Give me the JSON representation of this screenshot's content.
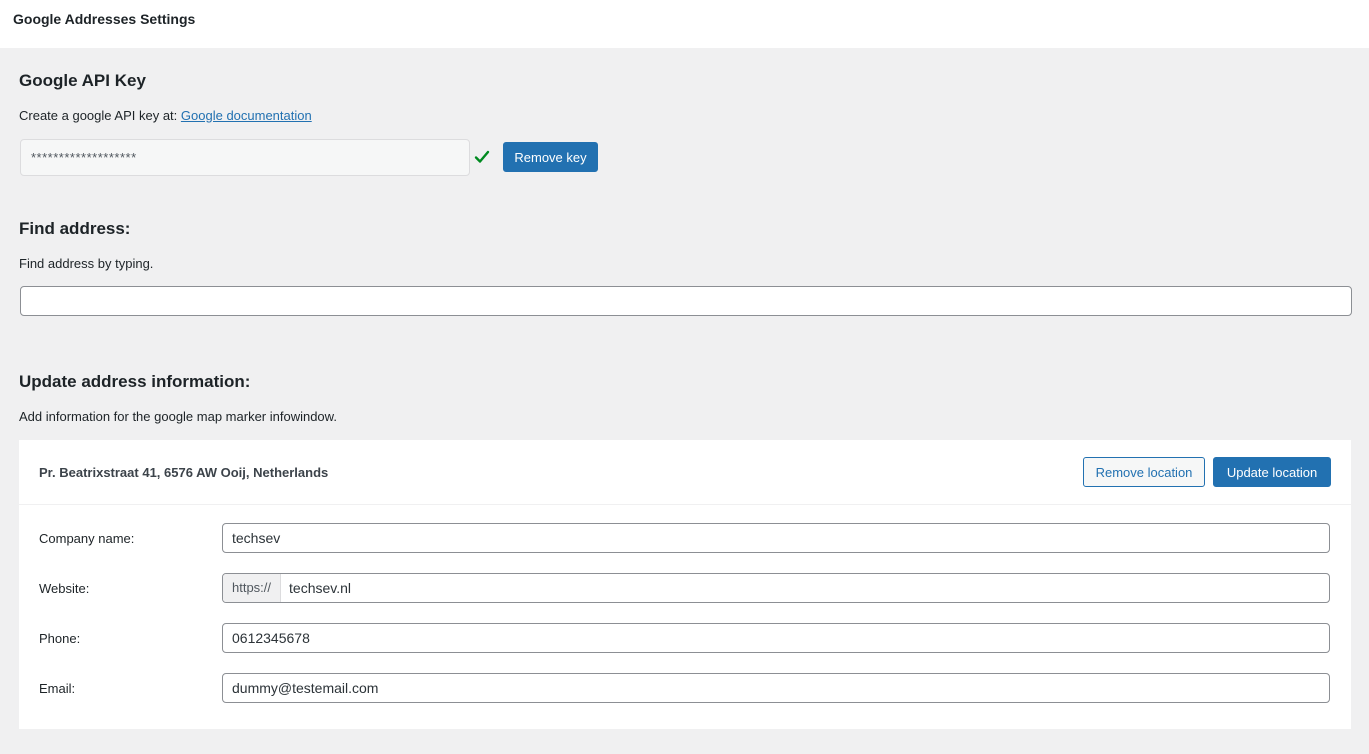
{
  "header": {
    "title": "Google Addresses Settings"
  },
  "api_key": {
    "heading": "Google API Key",
    "description_prefix": "Create a google API key at:",
    "doc_link": "Google documentation",
    "masked_value": "*******************",
    "status_icon": "checkmark-icon",
    "remove_label": "Remove key"
  },
  "find": {
    "heading": "Find address:",
    "description": "Find address by typing.",
    "value": ""
  },
  "update": {
    "heading": "Update address information:",
    "description": "Add information for the google map marker infowindow.",
    "address": "Pr. Beatrixstraat 41, 6576 AW Ooij, Netherlands",
    "remove_location": "Remove location",
    "update_location": "Update location",
    "fields": {
      "company": {
        "label": "Company name:",
        "value": "techsev"
      },
      "website": {
        "label": "Website:",
        "prefix": "https://",
        "value": "techsev.nl"
      },
      "phone": {
        "label": "Phone:",
        "value": "0612345678"
      },
      "email": {
        "label": "Email:",
        "value": "dummy@testemail.com"
      }
    }
  },
  "colors": {
    "accent": "#2271b1",
    "success": "#008a20",
    "background": "#f0f0f1"
  }
}
